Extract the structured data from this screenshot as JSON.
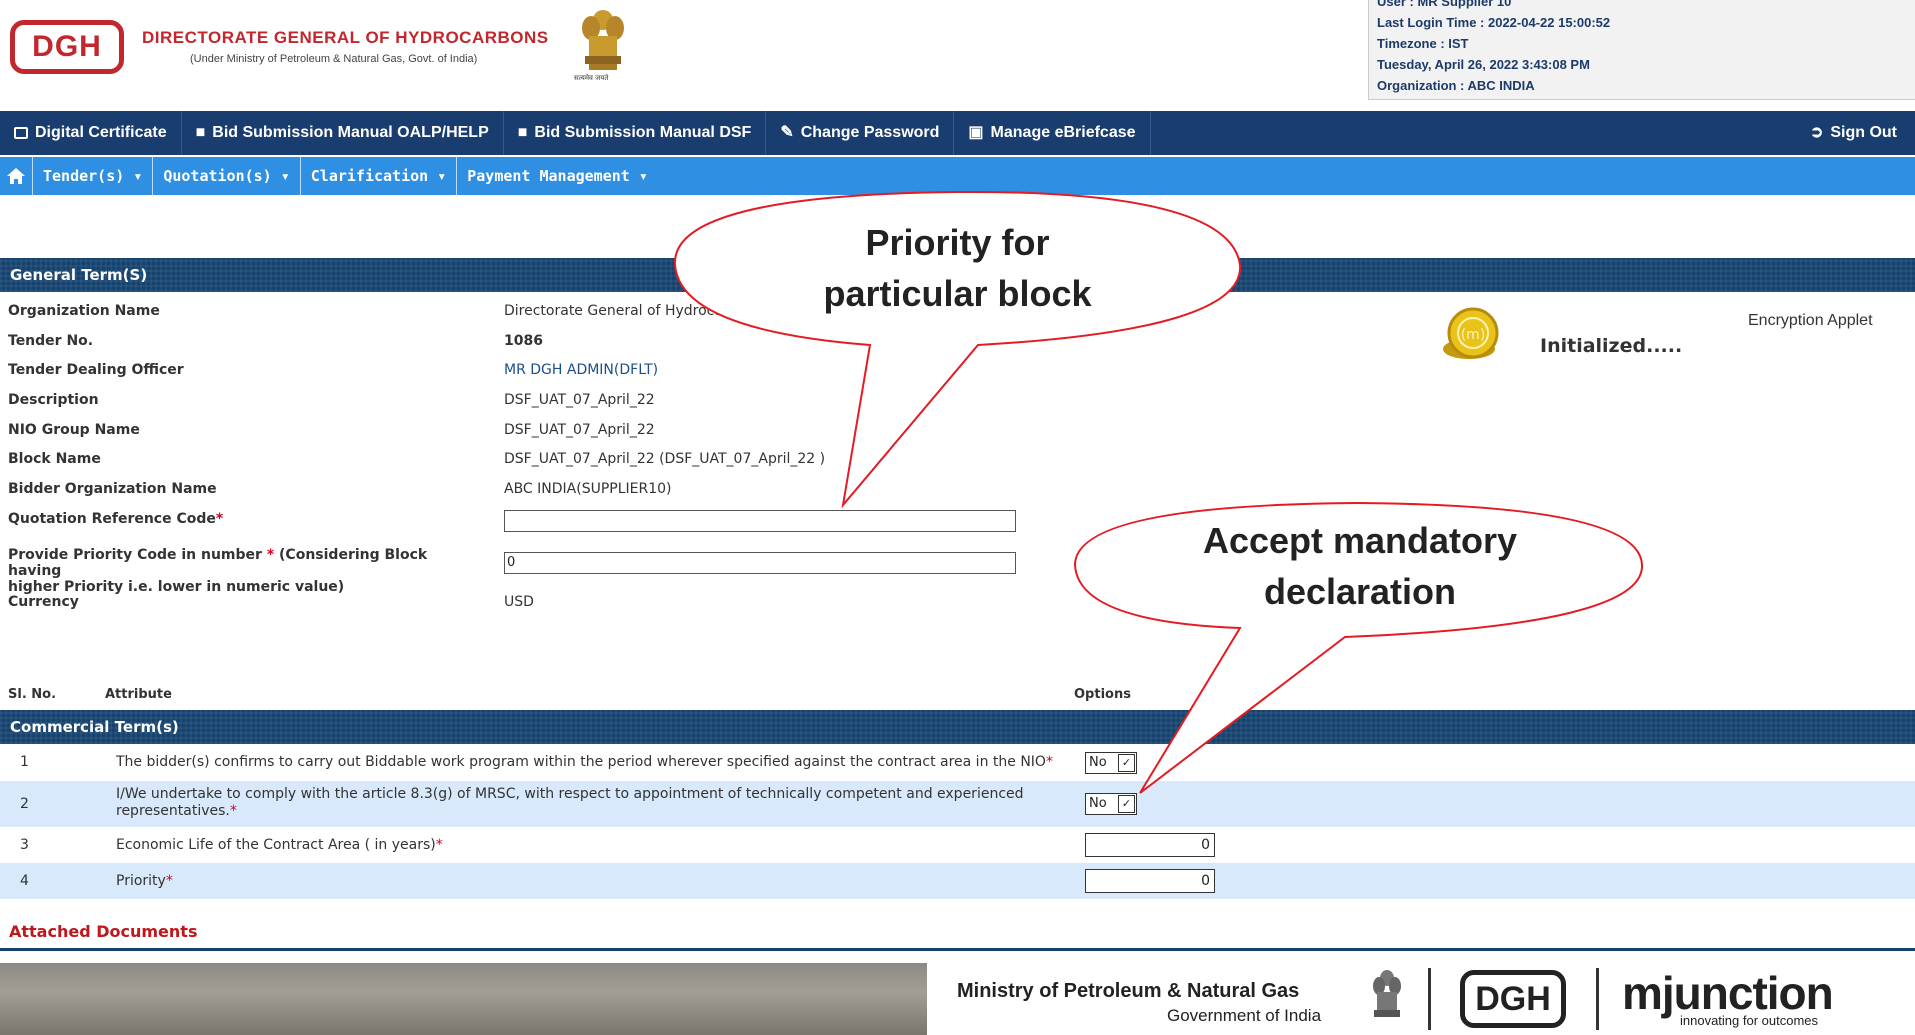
{
  "header": {
    "logo_text": "DGH",
    "org_title": "DIRECTORATE GENERAL OF HYDROCARBONS",
    "org_subtitle": "(Under Ministry of Petroleum & Natural Gas, Govt. of India)",
    "emblem_caption": "सत्यमेव जयते",
    "user_info": {
      "user": "User :   MR Supplier 10",
      "last_login": "Last Login Time : 2022-04-22 15:00:52",
      "timezone": "Timezone : IST",
      "datetime": "Tuesday, April 26, 2022  3:43:08 PM",
      "organization": "Organization : ABC INDIA"
    }
  },
  "top_nav": {
    "items": [
      "Digital Certificate",
      "Bid Submission Manual OALP/HELP",
      "Bid Submission Manual DSF",
      "Change Password",
      "Manage eBriefcase"
    ],
    "sign_out": "Sign Out"
  },
  "main_nav": {
    "items": [
      "Tender(s)",
      "Quotation(s)",
      "Clarification",
      "Payment Management"
    ]
  },
  "general_terms": {
    "title": "General Term(S)",
    "fields": [
      {
        "label": "Organization Name",
        "value": "Directorate General of Hydrocarbo"
      },
      {
        "label": "Tender No.",
        "value": "1086"
      },
      {
        "label": "Tender Dealing Officer",
        "value": "MR DGH ADMIN(DFLT)"
      },
      {
        "label": "Description",
        "value": "DSF_UAT_07_April_22"
      },
      {
        "label": "NIO Group Name",
        "value": "DSF_UAT_07_April_22"
      },
      {
        "label": "Block Name",
        "value": "DSF_UAT_07_April_22 (DSF_UAT_07_April_22 )"
      },
      {
        "label": "Bidder Organization Name",
        "value": "ABC INDIA(SUPPLIER10)"
      }
    ],
    "quotation_ref_label": "Quotation Reference Code",
    "quotation_ref_value": "",
    "priority_label_1": "Provide Priority Code in number",
    "priority_label_2": "(Considering Block having",
    "priority_label_3": "higher Priority i.e. lower in numeric value)",
    "priority_value": "0",
    "currency_label": "Currency",
    "currency_value": "USD",
    "required_mark": "*"
  },
  "applet": {
    "status": "Initialized.....",
    "label": "Encryption Applet"
  },
  "attributes_table": {
    "col_sl": "Sl. No.",
    "col_attribute": "Attribute",
    "col_options": "Options",
    "section_title": "Commercial Term(s)",
    "rows": [
      {
        "sl": "1",
        "attribute": "The bidder(s) confirms to carry out Biddable work program within the period wherever specified against the contract area in the NIO",
        "option": "No"
      },
      {
        "sl": "2",
        "attribute_line1": "I/We undertake to comply with the article 8.3(g) of MRSC, with respect to appointment of technically competent and experienced",
        "attribute_line2": "representatives.",
        "option": "No"
      },
      {
        "sl": "3",
        "attribute": "Economic Life of the Contract Area ( in years)",
        "option": "0"
      },
      {
        "sl": "4",
        "attribute": "Priority",
        "option": "0"
      }
    ]
  },
  "attached_documents": "Attached Documents",
  "callouts": {
    "priority_line1": "Priority for",
    "priority_line2": "particular block",
    "accept_line1": "Accept mandatory",
    "accept_line2": "declaration"
  },
  "footer": {
    "ministry": "Ministry of Petroleum & Natural Gas",
    "government": "Government of India",
    "dgh": "DGH",
    "mjunction": "mjunction",
    "tagline": "innovating for outcomes"
  },
  "colors": {
    "brand_red": "#c1272d",
    "nav_dark": "#1a3d6f",
    "nav_light": "#2f8fe3",
    "section_bar": "#15426e",
    "row_alt": "#d7e9fb",
    "required": "#d0021b"
  }
}
